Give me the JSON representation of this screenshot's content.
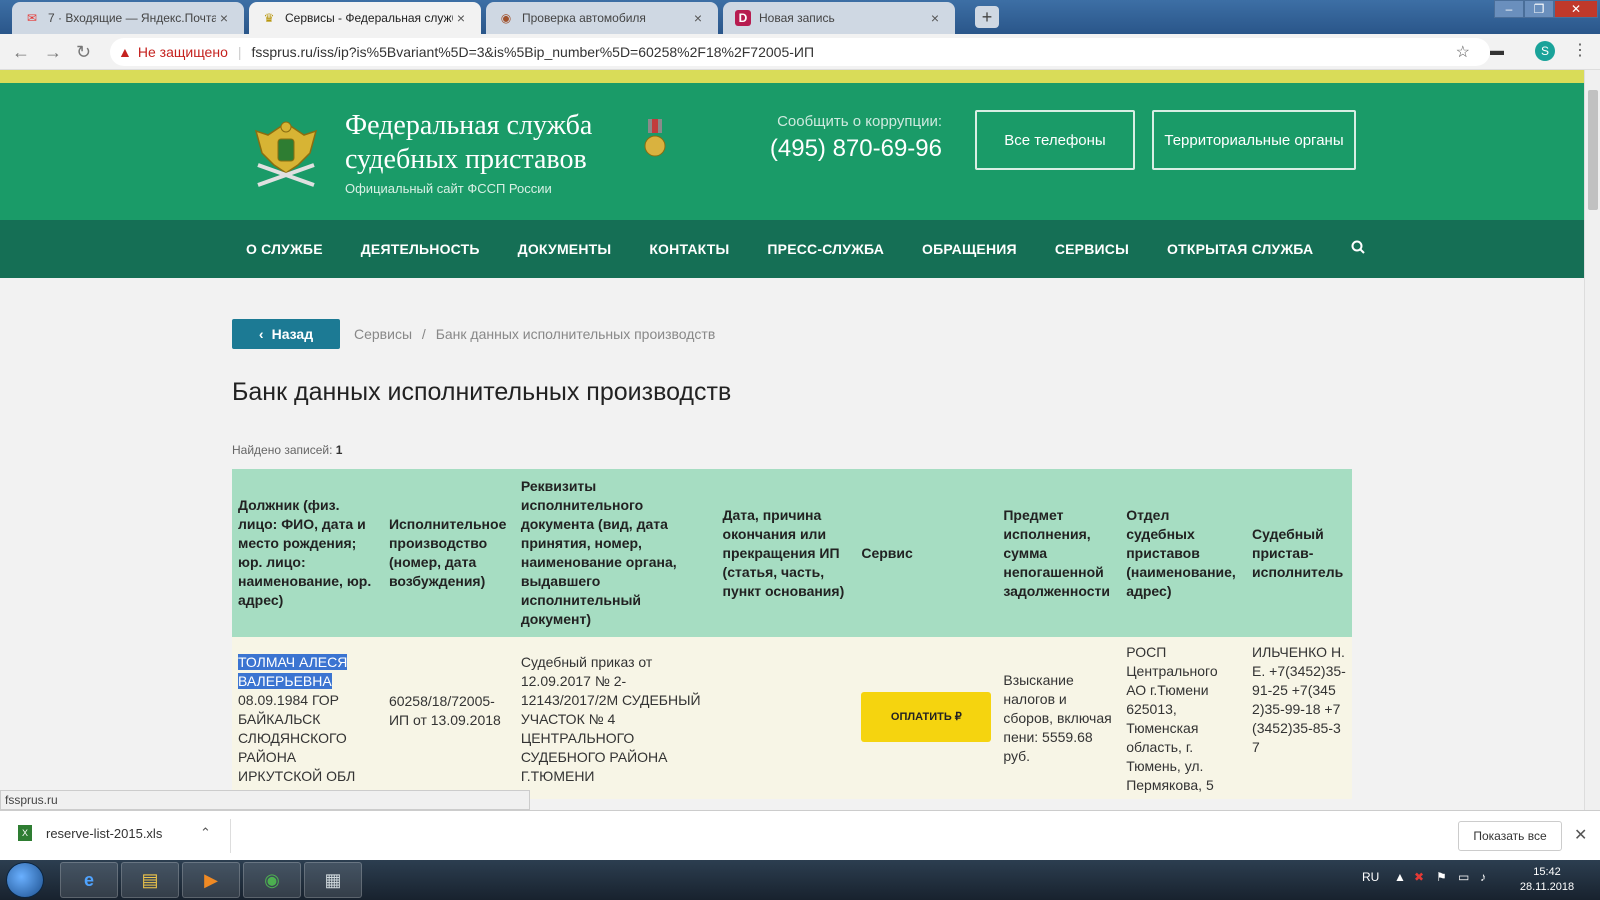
{
  "browser": {
    "tabs": [
      {
        "label": "7 · Входящие — Яндекс.Почта",
        "icon": "mail-icon"
      },
      {
        "label": "Сервисы - Федеральная служба",
        "icon": "emblem-icon"
      },
      {
        "label": "Проверка автомобиля",
        "icon": "car-check-icon"
      },
      {
        "label": "Новая запись",
        "icon": "d-icon"
      }
    ],
    "not_secure": "Не защищено",
    "url": "fssprus.ru/iss/ip?is%5Bvariant%5D=3&is%5Bip_number%5D=60258%2F18%2F72005-ИП",
    "profile_initial": "S",
    "status_url": "fssprus.ru"
  },
  "site": {
    "title_line1": "Федеральная служба",
    "title_line2": "судебных приставов",
    "subtitle": "Официальный сайт ФССП России",
    "corruption_label": "Сообщить о коррупции:",
    "corruption_phone": "(495) 870-69-96",
    "btn_phones": "Все телефоны",
    "btn_territorial": "Территориальные органы",
    "nav": [
      "О СЛУЖБЕ",
      "ДЕЯТЕЛЬНОСТЬ",
      "ДОКУМЕНТЫ",
      "КОНТАКТЫ",
      "ПРЕСС-СЛУЖБА",
      "ОБРАЩЕНИЯ",
      "СЕРВИСЫ",
      "ОТКРЫТАЯ СЛУЖБА"
    ]
  },
  "page": {
    "back_label": "Назад",
    "breadcrumb_1": "Сервисы",
    "breadcrumb_sep": "/",
    "breadcrumb_2": "Банк данных исполнительных производств",
    "title": "Банк данных исполнительных производств",
    "found_label": "Найдено записей:",
    "found_count": "1"
  },
  "table": {
    "headers": [
      "Должник (физ. лицо: ФИО, дата и место рождения; юр. лицо: наименование, юр. адрес)",
      "Исполнительное производство (номер, дата возбуждения)",
      "Реквизиты исполнительного документа (вид, дата принятия, номер, наименование органа, выдавшего исполнительный документ)",
      "Дата, причина окончания или прекращения ИП (статья, часть, пункт основания)",
      "Сервис",
      "Предмет исполнения, сумма непогашенной задолженности",
      "Отдел судебных приставов (наименование, адрес)",
      "Судебный пристав-исполнитель"
    ],
    "row": {
      "debtor_name": "ТОЛМАЧ АЛЕСЯ ВАЛЕРЬЕВНА",
      "debtor_details": "08.09.1984 ГОР БАЙКАЛЬСК СЛЮДЯНСКОГО РАЙОНА ИРКУТСКОЙ ОБЛ",
      "proceeding": "60258/18/72005-ИП от 13.09.2018",
      "document": "Судебный приказ от 12.09.2017 № 2-12143/2017/2М СУДЕБНЫЙ УЧАСТОК № 4 ЦЕНТРАЛЬНОГО СУДЕБНОГО РАЙОНА Г.ТЮМЕНИ",
      "end_info": "",
      "pay_label": "ОПЛАТИТЬ ₽",
      "subject": "Взыскание налогов и сборов, включая пени: 5559.68 руб.",
      "department": "РОСП Центрального АО г.Тюмени 625013, Тюменская область, г. Тюмень, ул. Пермякова, 5",
      "bailiff": "ИЛЬЧЕНКО Н. Е. +7(3452)35-91-25 +7(3452)35-99-18 +7(3452)35-85-37"
    }
  },
  "downloads": {
    "file": "reserve-list-2015.xls",
    "show_all": "Показать все"
  },
  "taskbar": {
    "lang": "RU",
    "time": "15:42",
    "date": "28.11.2018"
  },
  "colors": {
    "header_green": "#1a9b68",
    "nav_green": "#156f55",
    "table_header": "#a6ddc2",
    "pay_button": "#f5d40f",
    "back_button": "#1c7a94"
  }
}
